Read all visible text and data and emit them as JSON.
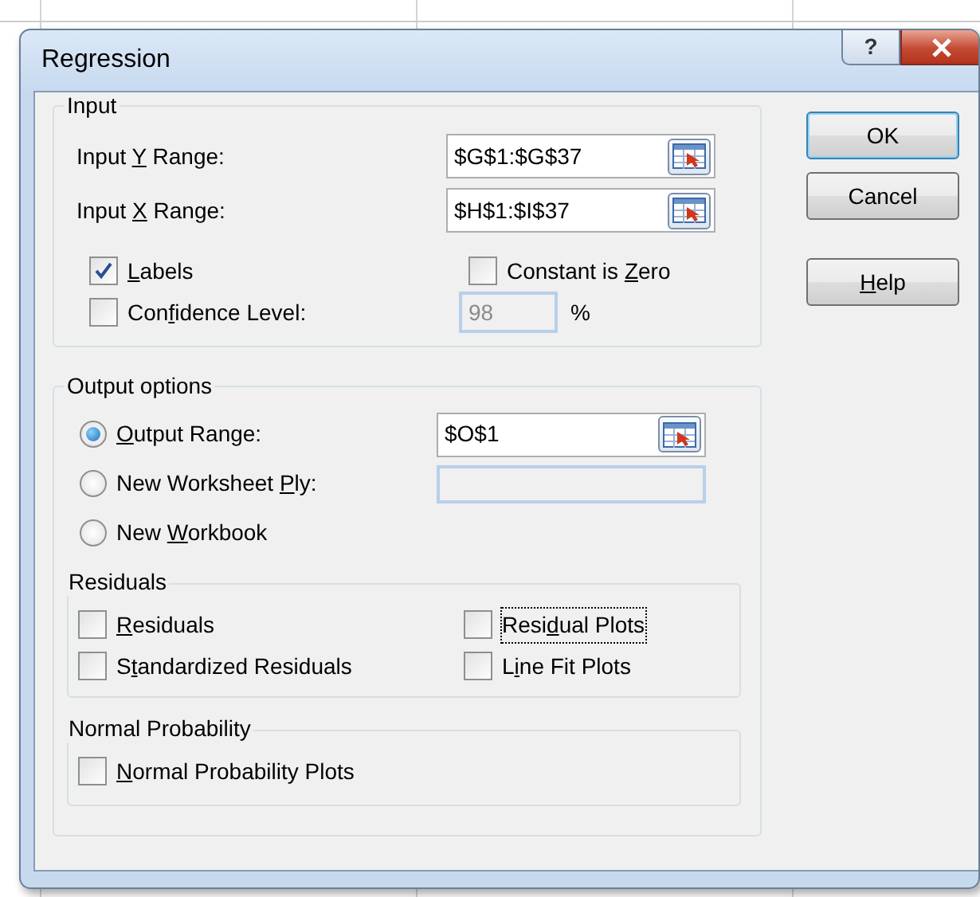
{
  "window": {
    "title": "Regression",
    "help_glyph": "?"
  },
  "input": {
    "title": "Input",
    "ranges": [
      {
        "label": {
          "before": "Input ",
          "key": "Y",
          "after": " Range:"
        },
        "value": "$G$1:$G$37"
      },
      {
        "label": {
          "before": "Input ",
          "key": "X",
          "after": " Range:"
        },
        "value": "$H$1:$I$37"
      }
    ],
    "options": [
      {
        "label": {
          "key": "L",
          "after": "abels"
        },
        "checked": true
      },
      {
        "label": {
          "before": "Constant is ",
          "key": "Z",
          "after": "ero"
        },
        "checked": false
      }
    ],
    "confidence": {
      "label": {
        "before": "Con",
        "key": "f",
        "after": "idence Level:"
      },
      "checked": false,
      "value": "98",
      "unit": "%",
      "disabled": true
    }
  },
  "output": {
    "title": "Output options",
    "destinations": [
      {
        "label": {
          "key": "O",
          "after": "utput Range:"
        },
        "selected": true,
        "kind": "range",
        "value": "$O$1"
      },
      {
        "label": {
          "before": "New Worksheet ",
          "key": "P",
          "after": "ly:"
        },
        "selected": false,
        "kind": "blank"
      },
      {
        "label": {
          "before": "New ",
          "key": "W",
          "after": "orkbook"
        },
        "selected": false,
        "kind": "none"
      }
    ],
    "residuals": {
      "title": "Residuals",
      "items": [
        {
          "label": {
            "key": "R",
            "after": "esiduals"
          },
          "checked": false,
          "focused": false
        },
        {
          "label": {
            "before": "Resi",
            "key": "d",
            "after": "ual Plots"
          },
          "checked": false,
          "focused": true
        },
        {
          "label": {
            "before": "S",
            "key": "t",
            "after": "andardized Residuals"
          },
          "checked": false,
          "focused": false
        },
        {
          "label": {
            "before": "L",
            "key": "i",
            "after": "ne Fit Plots"
          },
          "checked": false,
          "focused": false
        }
      ]
    },
    "normal": {
      "title": "Normal Probability",
      "items": [
        {
          "label": {
            "key": "N",
            "after": "ormal Probability Plots"
          },
          "checked": false,
          "focused": false
        }
      ]
    }
  },
  "buttons": [
    {
      "label": {
        "before": "OK"
      },
      "default": true
    },
    {
      "label": {
        "before": "Cancel"
      },
      "default": false
    },
    {
      "label": {
        "key": "H",
        "after": "elp"
      },
      "default": false
    }
  ]
}
